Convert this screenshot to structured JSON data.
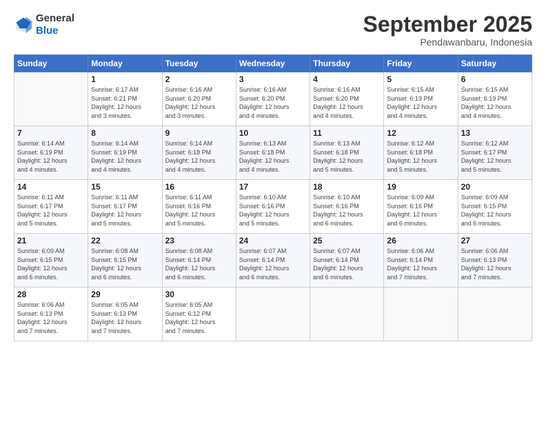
{
  "header": {
    "logo_general": "General",
    "logo_blue": "Blue",
    "month": "September 2025",
    "location": "Pendawanbaru, Indonesia"
  },
  "days_of_week": [
    "Sunday",
    "Monday",
    "Tuesday",
    "Wednesday",
    "Thursday",
    "Friday",
    "Saturday"
  ],
  "weeks": [
    [
      {
        "day": "",
        "info": ""
      },
      {
        "day": "1",
        "info": "Sunrise: 6:17 AM\nSunset: 6:21 PM\nDaylight: 12 hours\nand 3 minutes."
      },
      {
        "day": "2",
        "info": "Sunrise: 6:16 AM\nSunset: 6:20 PM\nDaylight: 12 hours\nand 3 minutes."
      },
      {
        "day": "3",
        "info": "Sunrise: 6:16 AM\nSunset: 6:20 PM\nDaylight: 12 hours\nand 4 minutes."
      },
      {
        "day": "4",
        "info": "Sunrise: 6:16 AM\nSunset: 6:20 PM\nDaylight: 12 hours\nand 4 minutes."
      },
      {
        "day": "5",
        "info": "Sunrise: 6:15 AM\nSunset: 6:19 PM\nDaylight: 12 hours\nand 4 minutes."
      },
      {
        "day": "6",
        "info": "Sunrise: 6:15 AM\nSunset: 6:19 PM\nDaylight: 12 hours\nand 4 minutes."
      }
    ],
    [
      {
        "day": "7",
        "info": "Sunrise: 6:14 AM\nSunset: 6:19 PM\nDaylight: 12 hours\nand 4 minutes."
      },
      {
        "day": "8",
        "info": "Sunrise: 6:14 AM\nSunset: 6:19 PM\nDaylight: 12 hours\nand 4 minutes."
      },
      {
        "day": "9",
        "info": "Sunrise: 6:14 AM\nSunset: 6:18 PM\nDaylight: 12 hours\nand 4 minutes."
      },
      {
        "day": "10",
        "info": "Sunrise: 6:13 AM\nSunset: 6:18 PM\nDaylight: 12 hours\nand 4 minutes."
      },
      {
        "day": "11",
        "info": "Sunrise: 6:13 AM\nSunset: 6:18 PM\nDaylight: 12 hours\nand 5 minutes."
      },
      {
        "day": "12",
        "info": "Sunrise: 6:12 AM\nSunset: 6:18 PM\nDaylight: 12 hours\nand 5 minutes."
      },
      {
        "day": "13",
        "info": "Sunrise: 6:12 AM\nSunset: 6:17 PM\nDaylight: 12 hours\nand 5 minutes."
      }
    ],
    [
      {
        "day": "14",
        "info": "Sunrise: 6:11 AM\nSunset: 6:17 PM\nDaylight: 12 hours\nand 5 minutes."
      },
      {
        "day": "15",
        "info": "Sunrise: 6:11 AM\nSunset: 6:17 PM\nDaylight: 12 hours\nand 5 minutes."
      },
      {
        "day": "16",
        "info": "Sunrise: 6:11 AM\nSunset: 6:16 PM\nDaylight: 12 hours\nand 5 minutes."
      },
      {
        "day": "17",
        "info": "Sunrise: 6:10 AM\nSunset: 6:16 PM\nDaylight: 12 hours\nand 5 minutes."
      },
      {
        "day": "18",
        "info": "Sunrise: 6:10 AM\nSunset: 6:16 PM\nDaylight: 12 hours\nand 6 minutes."
      },
      {
        "day": "19",
        "info": "Sunrise: 6:09 AM\nSunset: 6:16 PM\nDaylight: 12 hours\nand 6 minutes."
      },
      {
        "day": "20",
        "info": "Sunrise: 6:09 AM\nSunset: 6:15 PM\nDaylight: 12 hours\nand 6 minutes."
      }
    ],
    [
      {
        "day": "21",
        "info": "Sunrise: 6:09 AM\nSunset: 6:15 PM\nDaylight: 12 hours\nand 6 minutes."
      },
      {
        "day": "22",
        "info": "Sunrise: 6:08 AM\nSunset: 6:15 PM\nDaylight: 12 hours\nand 6 minutes."
      },
      {
        "day": "23",
        "info": "Sunrise: 6:08 AM\nSunset: 6:14 PM\nDaylight: 12 hours\nand 6 minutes."
      },
      {
        "day": "24",
        "info": "Sunrise: 6:07 AM\nSunset: 6:14 PM\nDaylight: 12 hours\nand 6 minutes."
      },
      {
        "day": "25",
        "info": "Sunrise: 6:07 AM\nSunset: 6:14 PM\nDaylight: 12 hours\nand 6 minutes."
      },
      {
        "day": "26",
        "info": "Sunrise: 6:06 AM\nSunset: 6:14 PM\nDaylight: 12 hours\nand 7 minutes."
      },
      {
        "day": "27",
        "info": "Sunrise: 6:06 AM\nSunset: 6:13 PM\nDaylight: 12 hours\nand 7 minutes."
      }
    ],
    [
      {
        "day": "28",
        "info": "Sunrise: 6:06 AM\nSunset: 6:13 PM\nDaylight: 12 hours\nand 7 minutes."
      },
      {
        "day": "29",
        "info": "Sunrise: 6:05 AM\nSunset: 6:13 PM\nDaylight: 12 hours\nand 7 minutes."
      },
      {
        "day": "30",
        "info": "Sunrise: 6:05 AM\nSunset: 6:12 PM\nDaylight: 12 hours\nand 7 minutes."
      },
      {
        "day": "",
        "info": ""
      },
      {
        "day": "",
        "info": ""
      },
      {
        "day": "",
        "info": ""
      },
      {
        "day": "",
        "info": ""
      }
    ]
  ]
}
